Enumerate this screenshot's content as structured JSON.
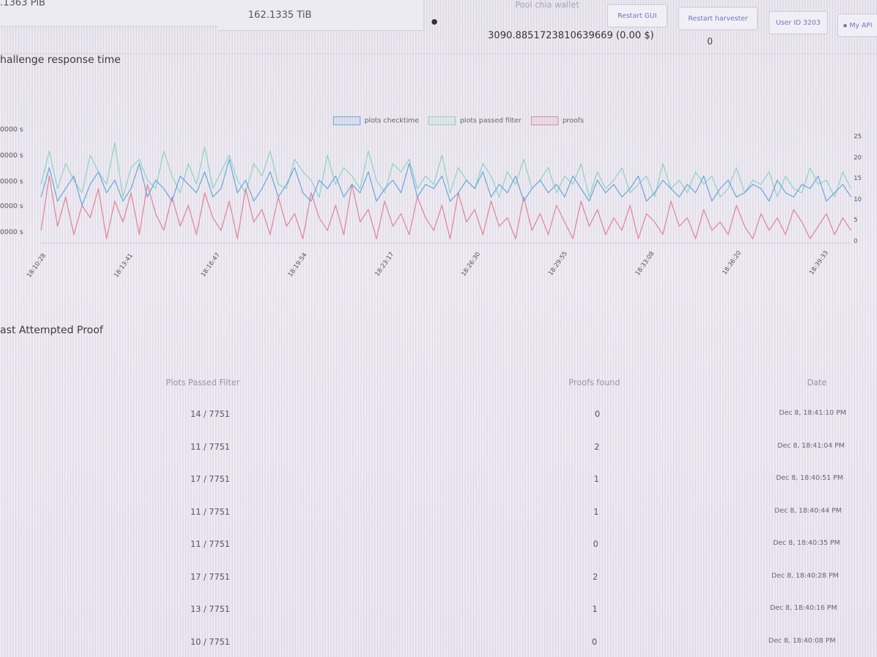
{
  "stats": {
    "netspace": ".1363 PiB",
    "plot_size": "162.1335 TiB",
    "wallet_label": "Pool chia wallet",
    "wallet_amount": "3090.8851723810639669 (0.00 $)",
    "counter": "0"
  },
  "buttons": {
    "restart_gui": "Restart GUI",
    "restart_harvester": "Restart harvester",
    "user_id": "User ID 3203",
    "my_api": "My API"
  },
  "chart_section": {
    "title": "hallenge response time"
  },
  "chart_data": {
    "type": "line",
    "legend": [
      "plots checktime",
      "plots passed filter",
      "proofs"
    ],
    "colors": {
      "plots_checktime": "#6aa7d9",
      "plots_passed_filter": "#8fd3c4",
      "proofs": "#e18497"
    },
    "y_left_ticks": [
      "0000 s",
      "0000 s",
      "0000 s",
      "0000 s",
      "0000 s"
    ],
    "y_right_ticks": [
      "25",
      "20",
      "15",
      "10",
      "5",
      "0"
    ],
    "x_ticks": [
      "18:10:28",
      "18:13:41",
      "18:16:47",
      "18:19:54",
      "18:23:17",
      "18:26:30",
      "18:29:55",
      "18:33:08",
      "18:36:20",
      "18:39:33"
    ],
    "y_right_range": [
      0,
      27
    ],
    "series": [
      {
        "name": "plots checktime",
        "values": [
          11,
          18,
          10,
          13,
          16,
          9,
          14,
          17,
          12,
          15,
          10,
          13,
          19,
          11,
          15,
          13,
          10,
          16,
          14,
          12,
          17,
          11,
          13,
          20,
          12,
          15,
          10,
          13,
          17,
          11,
          14,
          18,
          12,
          10,
          15,
          13,
          16,
          11,
          14,
          12,
          17,
          10,
          13,
          15,
          12,
          19,
          11,
          14,
          13,
          16,
          10,
          12,
          15,
          13,
          17,
          11,
          14,
          12,
          16,
          10,
          13,
          15,
          12,
          14,
          11,
          16,
          13,
          10,
          15,
          12,
          14,
          11,
          13,
          16,
          10,
          12,
          15,
          13,
          11,
          14,
          12,
          16,
          10,
          13,
          15,
          11,
          12,
          14,
          13,
          10,
          15,
          12,
          11,
          14,
          13,
          16,
          10,
          12,
          14,
          11
        ]
      },
      {
        "name": "plots passed filter",
        "values": [
          14,
          22,
          13,
          19,
          15,
          12,
          21,
          17,
          14,
          24,
          11,
          18,
          20,
          15,
          13,
          22,
          16,
          12,
          19,
          14,
          23,
          13,
          17,
          21,
          15,
          12,
          19,
          16,
          22,
          14,
          13,
          20,
          17,
          15,
          11,
          21,
          14,
          18,
          16,
          13,
          22,
          15,
          12,
          19,
          17,
          20,
          13,
          16,
          14,
          21,
          12,
          18,
          15,
          13,
          19,
          16,
          11,
          17,
          14,
          20,
          13,
          15,
          18,
          12,
          16,
          14,
          19,
          11,
          17,
          13,
          15,
          18,
          12,
          14,
          16,
          11,
          19,
          13,
          15,
          12,
          17,
          14,
          16,
          11,
          13,
          18,
          12,
          15,
          14,
          17,
          11,
          16,
          13,
          12,
          18,
          14,
          15,
          11,
          17,
          13
        ]
      },
      {
        "name": "proofs",
        "values": [
          3,
          16,
          4,
          11,
          2,
          9,
          6,
          13,
          1,
          10,
          5,
          12,
          2,
          14,
          7,
          3,
          11,
          4,
          9,
          2,
          12,
          6,
          3,
          10,
          1,
          13,
          5,
          8,
          2,
          11,
          4,
          7,
          1,
          12,
          6,
          3,
          9,
          2,
          14,
          5,
          8,
          1,
          10,
          4,
          7,
          2,
          11,
          6,
          3,
          9,
          1,
          12,
          5,
          8,
          2,
          10,
          4,
          6,
          1,
          11,
          3,
          7,
          2,
          9,
          5,
          1,
          10,
          4,
          8,
          2,
          6,
          3,
          9,
          1,
          7,
          5,
          2,
          10,
          4,
          6,
          1,
          8,
          3,
          5,
          2,
          9,
          4,
          1,
          7,
          3,
          6,
          2,
          8,
          5,
          1,
          4,
          7,
          2,
          6,
          3
        ]
      }
    ]
  },
  "proof_section": {
    "title": "ast Attempted Proof",
    "columns": [
      "Plots Passed Filter",
      "Proofs found",
      "Date"
    ],
    "rows": [
      {
        "passed": "14 / 7751",
        "proofs": "0",
        "date": "Dec 8, 18:41:10 PM"
      },
      {
        "passed": "11 / 7751",
        "proofs": "2",
        "date": "Dec 8, 18:41:04 PM"
      },
      {
        "passed": "17 / 7751",
        "proofs": "1",
        "date": "Dec 8, 18:40:51 PM"
      },
      {
        "passed": "11 / 7751",
        "proofs": "1",
        "date": "Dec 8, 18:40:44 PM"
      },
      {
        "passed": "11 / 7751",
        "proofs": "0",
        "date": "Dec 8, 18:40:35 PM"
      },
      {
        "passed": "17 / 7751",
        "proofs": "2",
        "date": "Dec 8, 18:40:28 PM"
      },
      {
        "passed": "13 / 7751",
        "proofs": "1",
        "date": "Dec 8, 18:40:16 PM"
      },
      {
        "passed": "10 / 7751",
        "proofs": "0",
        "date": "Dec 8, 18:40:08 PM"
      }
    ]
  }
}
